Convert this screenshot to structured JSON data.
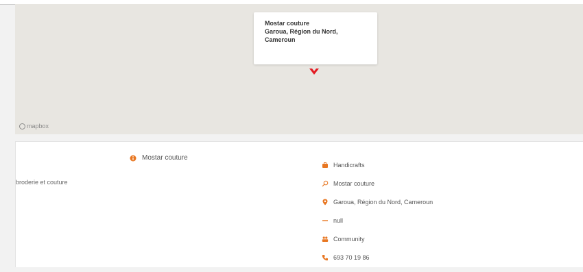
{
  "map": {
    "popup": {
      "line1": "Mostar couture",
      "line2": "Garoua, Région du Nord,",
      "line3": "Cameroun"
    },
    "attribution": "mapbox",
    "marker_color": "#e31b23"
  },
  "listing": {
    "name": "Mostar couture",
    "description": "broderie et couture",
    "accent_color": "#e87722",
    "details": [
      {
        "icon": "briefcase-icon",
        "text": "Handicrafts"
      },
      {
        "icon": "search-icon",
        "text": "Mostar couture"
      },
      {
        "icon": "map-pin-icon",
        "text": "Garoua, Région du Nord, Cameroun"
      },
      {
        "icon": "link-icon",
        "text": "null"
      },
      {
        "icon": "users-icon",
        "text": "Community"
      },
      {
        "icon": "phone-icon",
        "text": "693 70 19 86"
      }
    ]
  }
}
